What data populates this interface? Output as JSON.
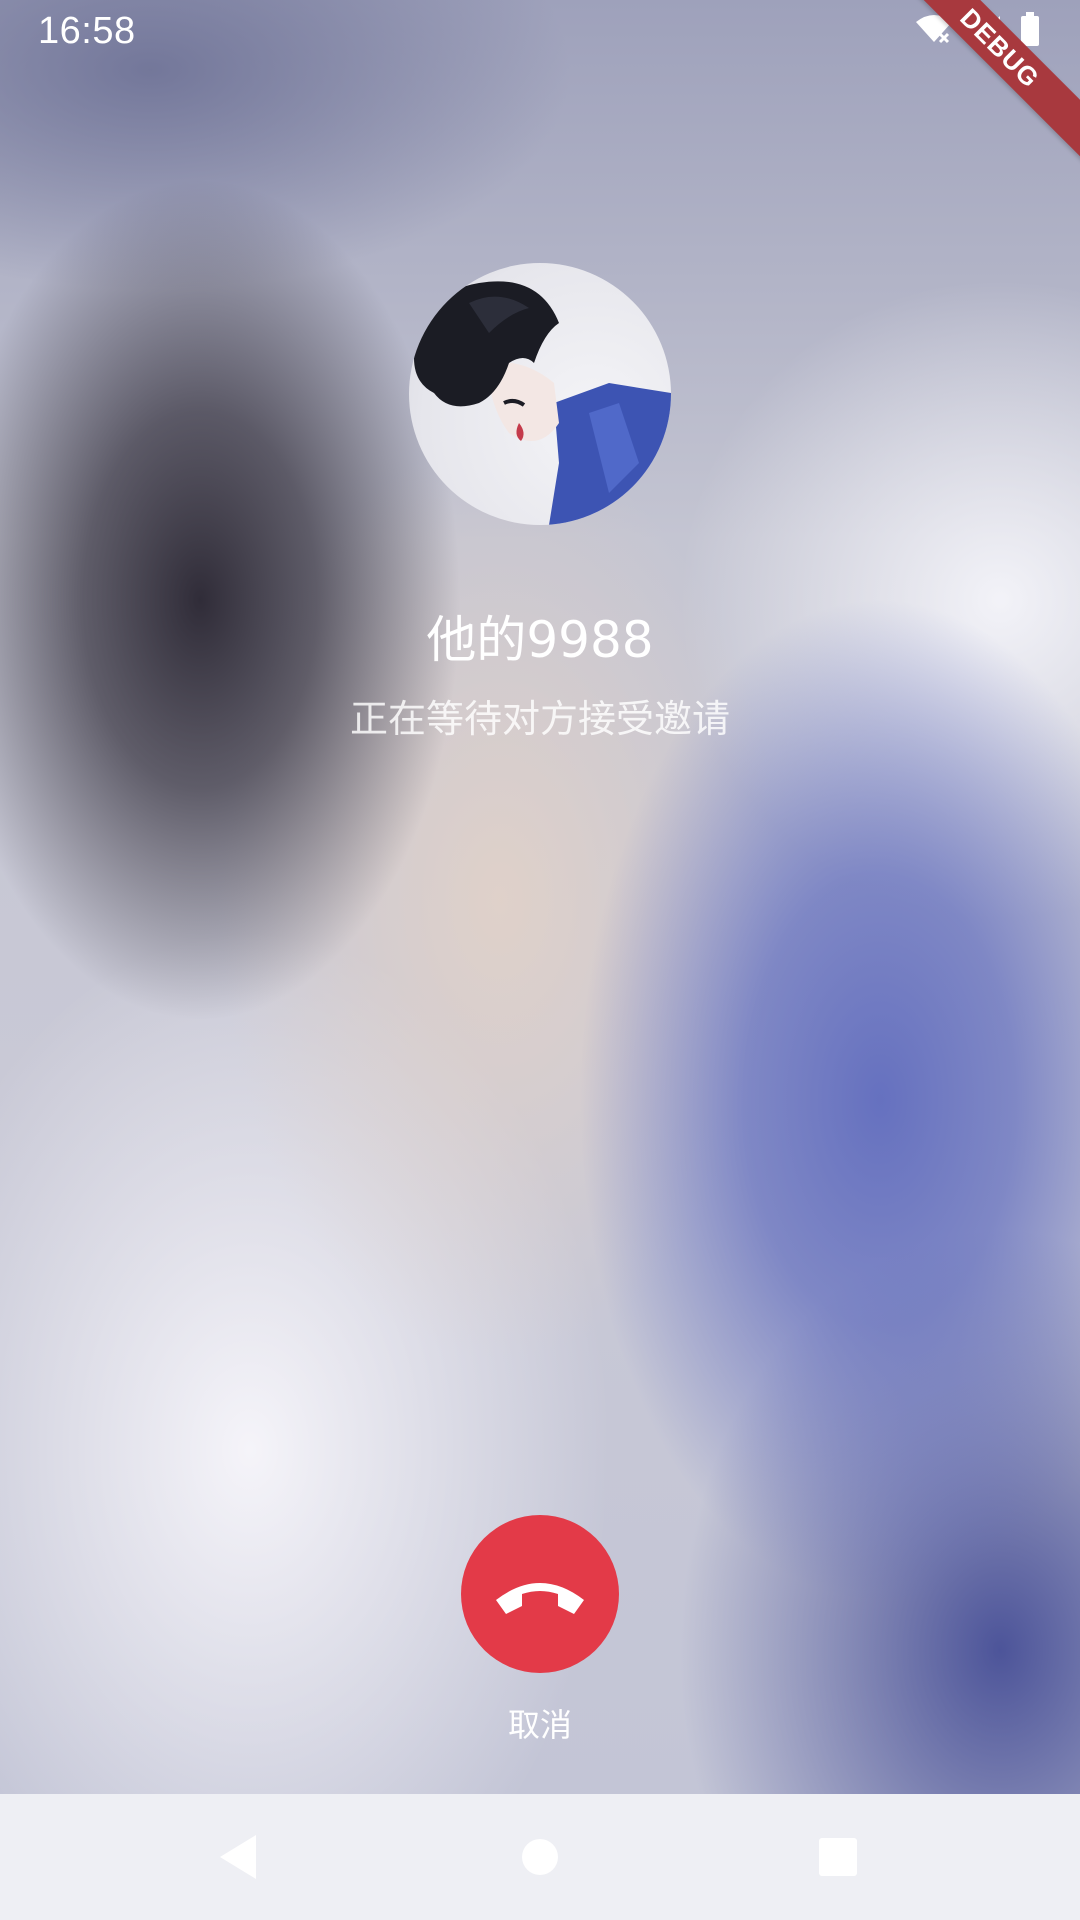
{
  "status_bar": {
    "time": "16:58",
    "debug_banner": "DEBUG",
    "icons": [
      "wifi-icon",
      "signal-icon",
      "battery-icon"
    ]
  },
  "call": {
    "caller_name": "他的9988",
    "status_text": "正在等待对方接受邀请",
    "avatar": "avatar-illustration",
    "cancel_label": "取消",
    "cancel_color": "#e33a48"
  },
  "nav": {
    "buttons": [
      "back-icon",
      "home-icon",
      "recents-icon"
    ]
  }
}
